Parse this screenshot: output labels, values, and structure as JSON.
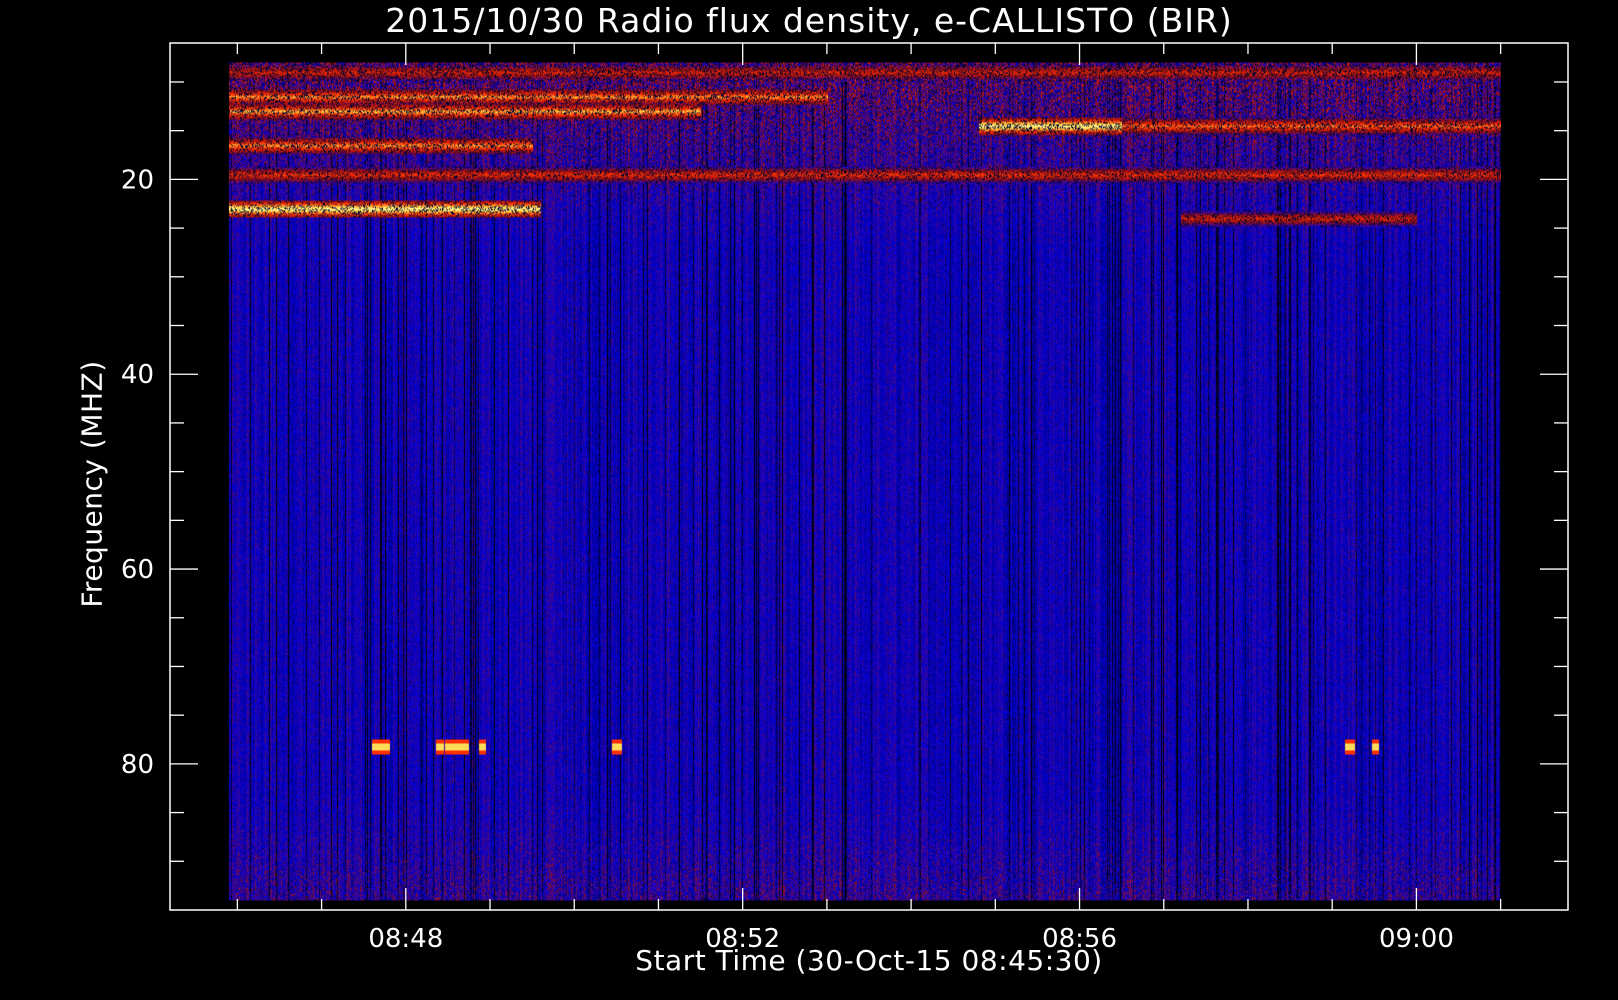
{
  "chart_data": {
    "type": "heatmap",
    "title": "2015/10/30  Radio flux density, e-CALLISTO (BIR)",
    "xlabel": "Start Time (30-Oct-15 08:45:30)",
    "ylabel": "Frequency (MHZ)",
    "x_tick_labels": [
      "08:48",
      "08:52",
      "08:56",
      "09:00"
    ],
    "x_tick_minutes": [
      168,
      172,
      176,
      180
    ],
    "xlim_minutes": [
      165.2,
      181.8
    ],
    "data_xlim_minutes": [
      165.9,
      181.0
    ],
    "y_tick_labels": [
      "20",
      "40",
      "60",
      "80"
    ],
    "y_ticks": [
      20,
      40,
      60,
      80
    ],
    "ylim": [
      95,
      6
    ],
    "data_ylim": [
      94,
      8
    ],
    "colormap": [
      "#000000",
      "#0000e0",
      "#a01010",
      "#ff3000",
      "#ffd040",
      "#ffffa0"
    ],
    "background_color": "#2a2aff",
    "bright_bands": [
      {
        "f": 9.0,
        "t0": 165.9,
        "t1": 181.0,
        "level": 0.55
      },
      {
        "f": 11.5,
        "t0": 165.9,
        "t1": 173.0,
        "level": 0.75
      },
      {
        "f": 13.0,
        "t0": 165.9,
        "t1": 171.5,
        "level": 0.8
      },
      {
        "f": 14.5,
        "t0": 174.8,
        "t1": 176.5,
        "level": 1.0
      },
      {
        "f": 14.5,
        "t0": 176.5,
        "t1": 181.0,
        "level": 0.7
      },
      {
        "f": 16.5,
        "t0": 165.9,
        "t1": 169.5,
        "level": 0.75
      },
      {
        "f": 19.5,
        "t0": 165.9,
        "t1": 181.0,
        "level": 0.6
      },
      {
        "f": 23.0,
        "t0": 165.9,
        "t1": 169.6,
        "level": 1.0
      },
      {
        "f": 24.0,
        "t0": 177.2,
        "t1": 180.0,
        "level": 0.55
      }
    ],
    "bursts": [
      {
        "t": 167.7,
        "f": 78.2,
        "w": 0.22
      },
      {
        "t": 168.4,
        "f": 78.2,
        "w": 0.1
      },
      {
        "t": 168.6,
        "f": 78.2,
        "w": 0.28
      },
      {
        "t": 168.9,
        "f": 78.2,
        "w": 0.08
      },
      {
        "t": 170.5,
        "f": 78.2,
        "w": 0.12
      },
      {
        "t": 179.2,
        "f": 78.2,
        "w": 0.12
      },
      {
        "t": 179.5,
        "f": 78.2,
        "w": 0.08
      }
    ]
  }
}
